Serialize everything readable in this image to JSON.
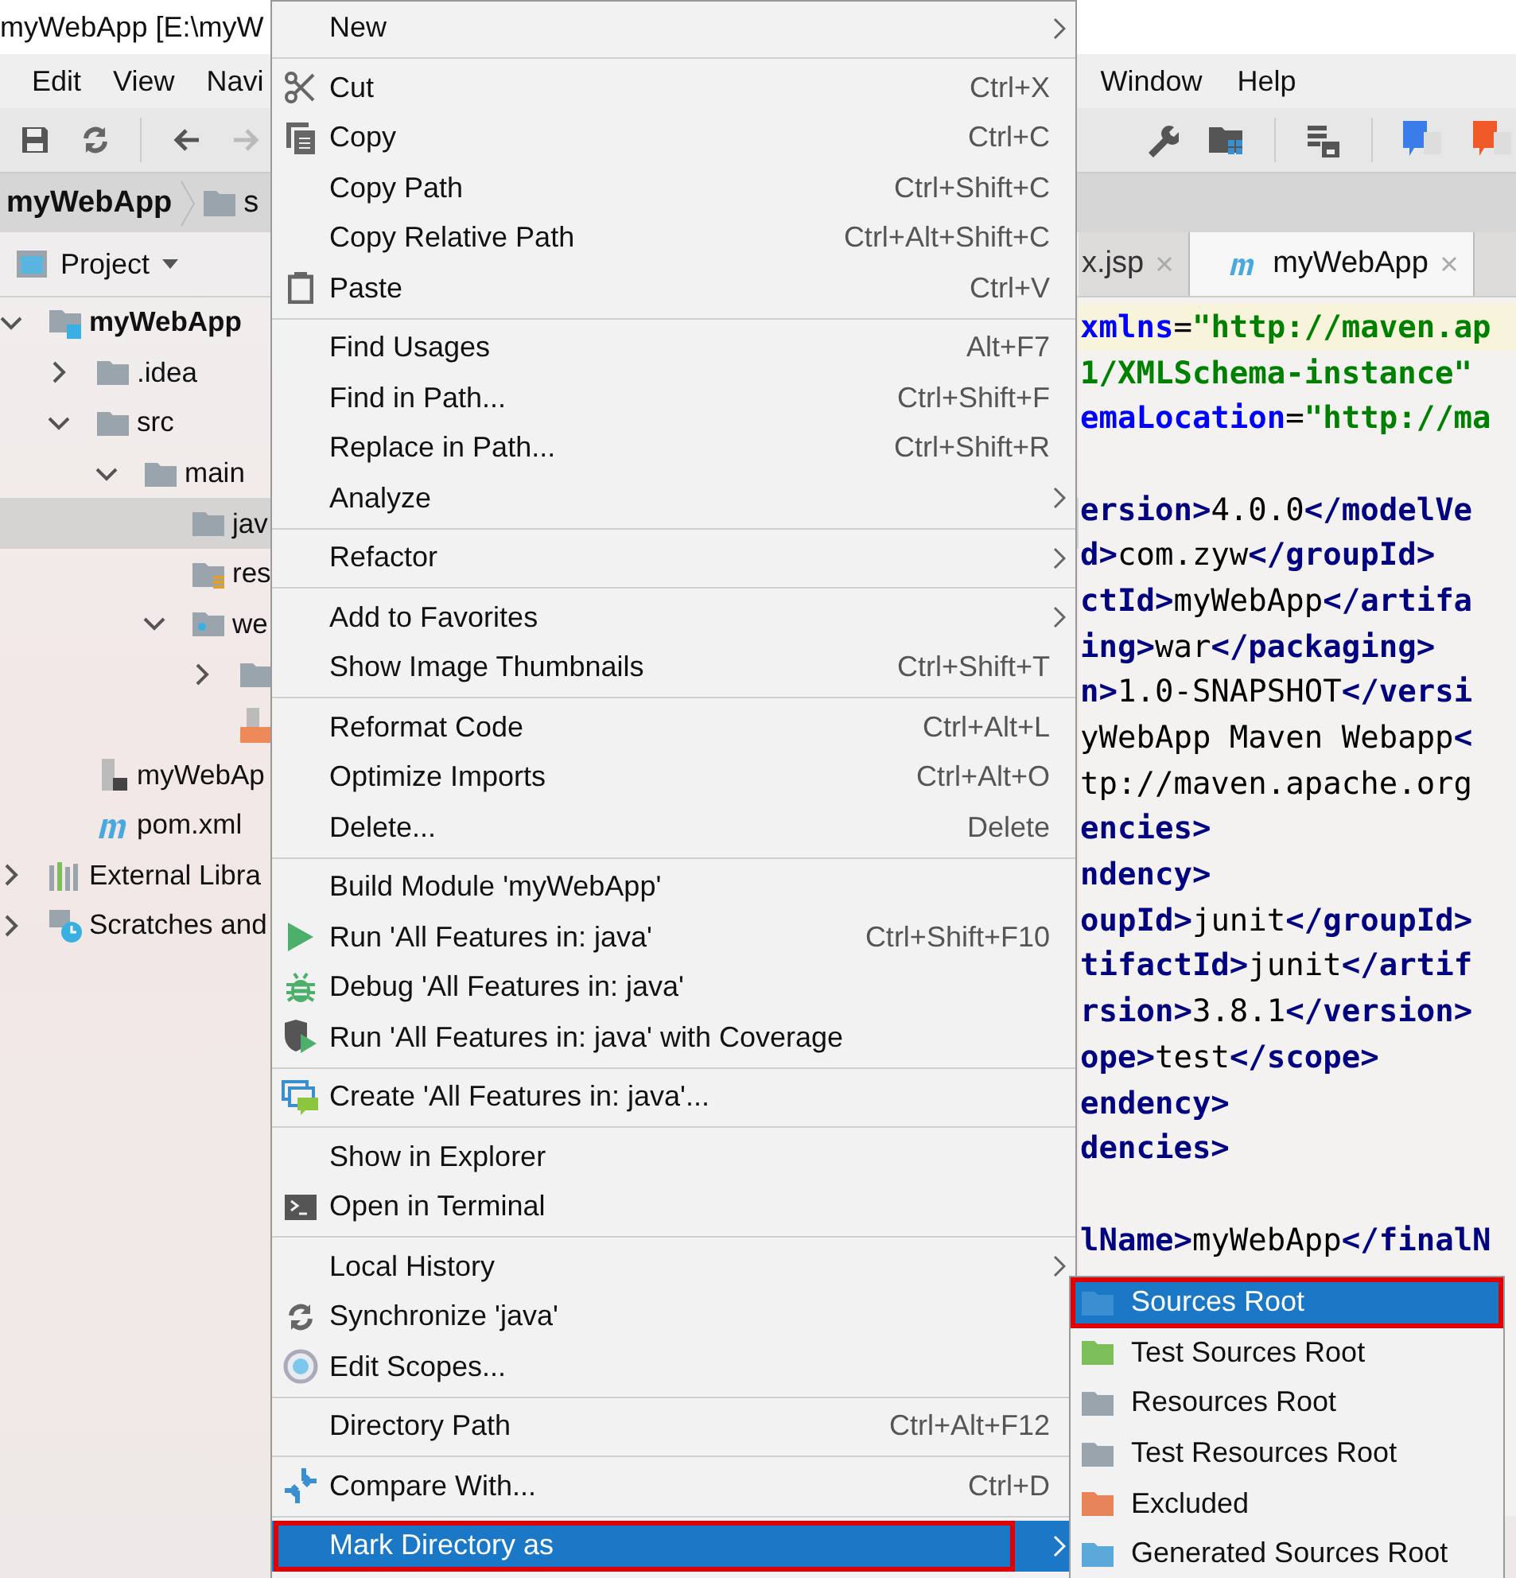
{
  "window": {
    "title": "myWebApp [E:\\myW"
  },
  "menu_bar": {
    "left": [
      "Edit",
      "View",
      "Navi"
    ],
    "right": [
      "Window",
      "Help"
    ]
  },
  "breadcrumb": [
    "myWebApp",
    "s"
  ],
  "project_panel": {
    "title": "Project",
    "tree": [
      {
        "label": "myWebApp",
        "kind": "module",
        "expanded": true,
        "selected": false,
        "children": [
          {
            "label": ".idea",
            "kind": "folder",
            "expanded": false,
            "selected": false
          },
          {
            "label": "src",
            "kind": "folder",
            "expanded": true,
            "selected": false,
            "children": [
              {
                "label": "main",
                "kind": "folder",
                "expanded": true,
                "selected": false,
                "children": [
                  {
                    "label": "jav",
                    "kind": "folder",
                    "selected": true
                  },
                  {
                    "label": "res",
                    "kind": "resources_folder",
                    "selected": false
                  },
                  {
                    "label": "we",
                    "kind": "web_folder",
                    "expanded": true,
                    "selected": false,
                    "children": [
                      {
                        "kind": "folder",
                        "expanded": false,
                        "selected": false
                      },
                      {
                        "kind": "jsp_file",
                        "selected": false
                      }
                    ]
                  }
                ]
              }
            ]
          },
          {
            "label": "myWebAp",
            "kind": "module_file",
            "selected": false
          },
          {
            "label": "pom.xml",
            "kind": "maven_file",
            "selected": false
          }
        ]
      },
      {
        "label": "External Libra",
        "kind": "libraries",
        "expanded": false,
        "selected": false
      },
      {
        "label": "Scratches and",
        "kind": "scratches",
        "expanded": false,
        "selected": false
      }
    ]
  },
  "editor": {
    "tabs": [
      {
        "label": "x.jsp",
        "selected": false
      },
      {
        "label": "myWebApp",
        "selected": true
      }
    ],
    "lines": [
      {
        "kind": "code",
        "current": true,
        "segments": [
          {
            "t": "xmlns",
            "kind": "attr"
          },
          {
            "t": "=",
            "kind": "text"
          },
          {
            "t": "\"http://maven.ap",
            "kind": "str"
          }
        ]
      },
      {
        "kind": "code",
        "current": false,
        "segments": [
          {
            "t": "1/XMLSchema-instance\"",
            "kind": "str"
          }
        ]
      },
      {
        "kind": "code",
        "current": false,
        "segments": [
          {
            "t": "emaLocation",
            "kind": "attr"
          },
          {
            "t": "=",
            "kind": "text"
          },
          {
            "t": "\"http://ma",
            "kind": "str"
          }
        ]
      },
      {
        "kind": "blank",
        "current": false
      },
      {
        "kind": "code",
        "current": false,
        "segments": [
          {
            "t": "ersion>",
            "kind": "tag"
          },
          {
            "t": "4.0.0",
            "kind": "text"
          },
          {
            "t": "</modelVe",
            "kind": "tag"
          }
        ]
      },
      {
        "kind": "code",
        "current": false,
        "segments": [
          {
            "t": "d>",
            "kind": "tag"
          },
          {
            "t": "com.zyw",
            "kind": "text"
          },
          {
            "t": "</groupId>",
            "kind": "tag"
          }
        ]
      },
      {
        "kind": "code",
        "current": false,
        "segments": [
          {
            "t": "ctId>",
            "kind": "tag"
          },
          {
            "t": "myWebApp",
            "kind": "text"
          },
          {
            "t": "</artifa",
            "kind": "tag"
          }
        ]
      },
      {
        "kind": "code",
        "current": false,
        "segments": [
          {
            "t": "ing>",
            "kind": "tag"
          },
          {
            "t": "war",
            "kind": "text"
          },
          {
            "t": "</packaging>",
            "kind": "tag"
          }
        ]
      },
      {
        "kind": "code",
        "current": false,
        "segments": [
          {
            "t": "n>",
            "kind": "tag"
          },
          {
            "t": "1.0-SNAPSHOT",
            "kind": "text"
          },
          {
            "t": "</versi",
            "kind": "tag"
          }
        ]
      },
      {
        "kind": "code",
        "current": false,
        "segments": [
          {
            "t": "yWebApp Maven Webapp",
            "kind": "text"
          },
          {
            "t": "<",
            "kind": "tag"
          }
        ]
      },
      {
        "kind": "code",
        "current": false,
        "segments": [
          {
            "t": "tp://maven.apache.org",
            "kind": "text"
          }
        ]
      },
      {
        "kind": "code",
        "current": false,
        "segments": [
          {
            "t": "encies>",
            "kind": "tag"
          }
        ]
      },
      {
        "kind": "code",
        "current": false,
        "segments": [
          {
            "t": "ndency>",
            "kind": "tag"
          }
        ]
      },
      {
        "kind": "code",
        "current": false,
        "segments": [
          {
            "t": "oupId>",
            "kind": "tag"
          },
          {
            "t": "junit",
            "kind": "text"
          },
          {
            "t": "</groupId>",
            "kind": "tag"
          }
        ]
      },
      {
        "kind": "code",
        "current": false,
        "segments": [
          {
            "t": "tifactId>",
            "kind": "tag"
          },
          {
            "t": "junit",
            "kind": "text"
          },
          {
            "t": "</artif",
            "kind": "tag"
          }
        ]
      },
      {
        "kind": "code",
        "current": false,
        "segments": [
          {
            "t": "rsion>",
            "kind": "tag"
          },
          {
            "t": "3.8.1",
            "kind": "text"
          },
          {
            "t": "</version>",
            "kind": "tag"
          }
        ]
      },
      {
        "kind": "code",
        "current": false,
        "segments": [
          {
            "t": "ope>",
            "kind": "tag"
          },
          {
            "t": "test",
            "kind": "text"
          },
          {
            "t": "</scope>",
            "kind": "tag"
          }
        ]
      },
      {
        "kind": "code",
        "current": false,
        "segments": [
          {
            "t": "endency>",
            "kind": "tag"
          }
        ]
      },
      {
        "kind": "code",
        "current": false,
        "segments": [
          {
            "t": "dencies>",
            "kind": "tag"
          }
        ]
      },
      {
        "kind": "blank",
        "current": false
      },
      {
        "kind": "code",
        "current": false,
        "segments": [
          {
            "t": "lName>",
            "kind": "tag"
          },
          {
            "t": "myWebApp",
            "kind": "text"
          },
          {
            "t": "</finalN",
            "kind": "tag"
          }
        ]
      }
    ]
  },
  "context_menu": {
    "groups": [
      [
        {
          "label": "New",
          "submenu": true,
          "selected": false
        }
      ],
      [
        {
          "label": "Cut",
          "shortcut": "Ctrl+X",
          "submenu": false,
          "selected": false
        },
        {
          "label": "Copy",
          "shortcut": "Ctrl+C",
          "submenu": false,
          "selected": false
        },
        {
          "label": "Copy Path",
          "shortcut": "Ctrl+Shift+C",
          "submenu": false,
          "selected": false
        },
        {
          "label": "Copy Relative Path",
          "shortcut": "Ctrl+Alt+Shift+C",
          "submenu": false,
          "selected": false
        },
        {
          "label": "Paste",
          "shortcut": "Ctrl+V",
          "submenu": false,
          "selected": false
        }
      ],
      [
        {
          "label": "Find Usages",
          "shortcut": "Alt+F7",
          "submenu": false,
          "selected": false
        },
        {
          "label": "Find in Path...",
          "shortcut": "Ctrl+Shift+F",
          "submenu": false,
          "selected": false
        },
        {
          "label": "Replace in Path...",
          "shortcut": "Ctrl+Shift+R",
          "submenu": false,
          "selected": false
        },
        {
          "label": "Analyze",
          "submenu": true,
          "selected": false
        }
      ],
      [
        {
          "label": "Refactor",
          "submenu": true,
          "selected": false
        }
      ],
      [
        {
          "label": "Add to Favorites",
          "submenu": true,
          "selected": false
        },
        {
          "label": "Show Image Thumbnails",
          "shortcut": "Ctrl+Shift+T",
          "submenu": false,
          "selected": false
        }
      ],
      [
        {
          "label": "Reformat Code",
          "shortcut": "Ctrl+Alt+L",
          "submenu": false,
          "selected": false
        },
        {
          "label": "Optimize Imports",
          "shortcut": "Ctrl+Alt+O",
          "submenu": false,
          "selected": false
        },
        {
          "label": "Delete...",
          "shortcut": "Delete",
          "submenu": false,
          "selected": false
        }
      ],
      [
        {
          "label": "Build Module 'myWebApp'",
          "submenu": false,
          "selected": false
        },
        {
          "label": "Run 'All Features in: java'",
          "shortcut": "Ctrl+Shift+F10",
          "submenu": false,
          "selected": false
        },
        {
          "label": "Debug 'All Features in: java'",
          "submenu": false,
          "selected": false
        },
        {
          "label": "Run 'All Features in: java' with Coverage",
          "submenu": false,
          "selected": false
        }
      ],
      [
        {
          "label": "Create 'All Features in: java'...",
          "submenu": false,
          "selected": false
        }
      ],
      [
        {
          "label": "Show in Explorer",
          "submenu": false,
          "selected": false
        },
        {
          "label": "Open in Terminal",
          "submenu": false,
          "selected": false
        }
      ],
      [
        {
          "label": "Local History",
          "submenu": true,
          "selected": false
        },
        {
          "label": "Synchronize 'java'",
          "submenu": false,
          "selected": false
        },
        {
          "label": "Edit Scopes...",
          "submenu": false,
          "selected": false
        }
      ],
      [
        {
          "label": "Directory Path",
          "shortcut": "Ctrl+Alt+F12",
          "submenu": false,
          "selected": false
        }
      ],
      [
        {
          "label": "Compare With...",
          "shortcut": "Ctrl+D",
          "submenu": false,
          "selected": false
        }
      ],
      [
        {
          "label": "Mark Directory as",
          "submenu": true,
          "selected": true
        }
      ]
    ]
  },
  "submenu": {
    "items": [
      {
        "label": "Sources Root",
        "selected": true
      },
      {
        "label": "Test Sources Root",
        "selected": false
      },
      {
        "label": "Resources Root",
        "selected": false
      },
      {
        "label": "Test Resources Root",
        "selected": false
      },
      {
        "label": "Excluded",
        "selected": false
      },
      {
        "label": "Generated Sources Root",
        "selected": false
      }
    ]
  }
}
